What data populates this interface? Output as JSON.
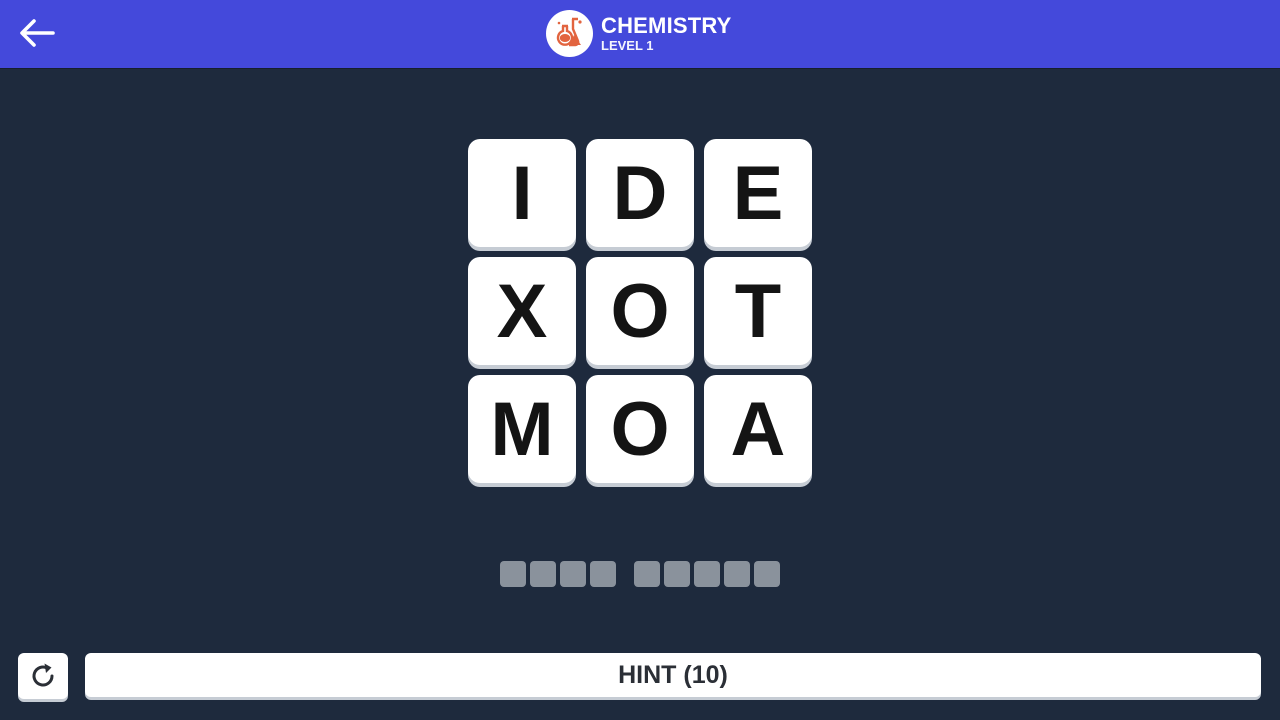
{
  "header": {
    "title": "CHEMISTRY",
    "subtitle": "LEVEL 1",
    "back_icon": "back-arrow-icon",
    "category_icon": "chemistry-flasks-icon",
    "bar_color": "#4449db",
    "icon_accent": "#e2643f"
  },
  "board": {
    "tiles": [
      "I",
      "D",
      "E",
      "X",
      "O",
      "T",
      "M",
      "O",
      "A"
    ]
  },
  "answer": {
    "words": [
      4,
      5
    ]
  },
  "footer": {
    "reset_icon": "refresh-icon",
    "hint_label": "HINT (10)"
  }
}
